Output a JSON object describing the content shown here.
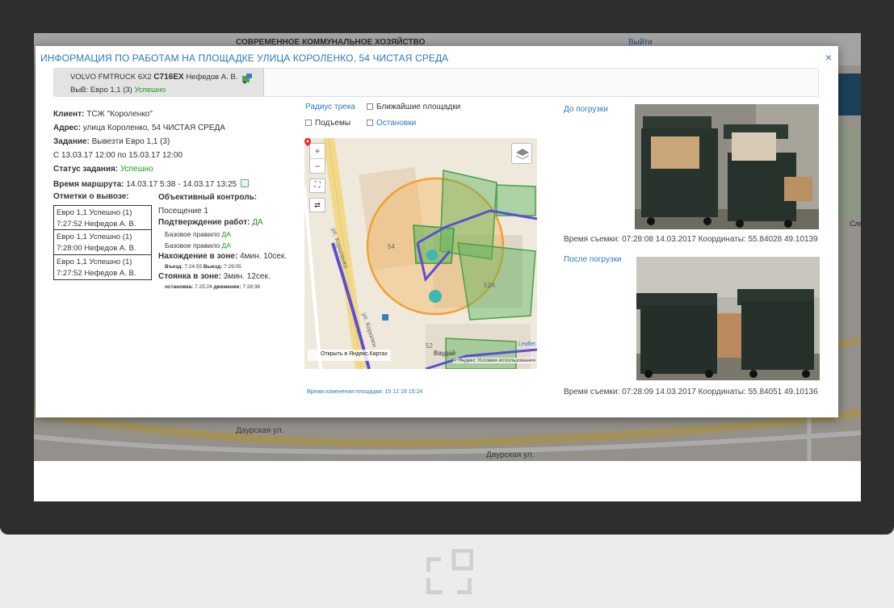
{
  "background": {
    "header_left": "СОВРЕМЕННОЕ КОММУНАЛЬНОЕ ХОЗЯЙСТВО",
    "header_right": "Выйти",
    "right_text": "Сло",
    "street_1": "Даурская ул.",
    "street_2": "Даурская ул."
  },
  "modal": {
    "title": "ИНФОРМАЦИЯ ПО РАБОТАМ НА ПЛОЩАДКЕ УЛИЦА КОРОЛЕНКО, 54 ЧИСТАЯ СРЕДА",
    "close": "×"
  },
  "truck": {
    "model": "VOLVO FMTRUCK 6X2",
    "plate": "С716ЕХ",
    "driver": "Нефедов А. В.",
    "task_prefix": "ВыВ: Евро 1,1 (3)",
    "status": "Успешно"
  },
  "info": {
    "client_label": "Клиент:",
    "client": "ТСЖ \"Короленко\"",
    "address_label": "Адрес:",
    "address": "улица Короленко, 54 ЧИСТАЯ СРЕДА",
    "task_label": "Задание:",
    "task": "Вывезти Евро 1,1 (3)",
    "period": "С 13.03.17 12:00 по 15.03.17 12:00",
    "status_label": "Статус задания:",
    "status": "Успешно",
    "route_label": "Время маршрута:",
    "route": "14.03.17 5:38 - 14.03.17 13:25"
  },
  "marks": {
    "title": "Отметки о вывозе:",
    "items": [
      {
        "line1": "Евро 1,1 Успешно (1)",
        "line2": "7:27:52 Нефедов А. В."
      },
      {
        "line1": "Евро 1,1 Успешно (1)",
        "line2": "7:28:00 Нефедов А. В."
      },
      {
        "line1": "Евро 1,1 Успешно (1)",
        "line2": "7:27:52 Нефедов А. В."
      }
    ]
  },
  "objective": {
    "title": "Объективный контроль:",
    "visit": "Посещение 1",
    "confirm_label": "Подтверждение работ:",
    "confirm_value": "ДА",
    "rule1_label": "Базовое правило",
    "rule1_value": "ДА",
    "rule2_label": "Базовое правило",
    "rule2_value": "ДА",
    "zone_label": "Нахождение в зоне:",
    "zone_value": "4мин. 10сек.",
    "entry_label": "Въезд:",
    "entry_time": "7:24:55",
    "exit_label": "Выезд:",
    "exit_time": "7:29:05",
    "parking_label": "Стоянка в зоне:",
    "parking_value": "3мин. 12сек.",
    "stop_label": "остановка:",
    "stop_time": "7:25:24",
    "move_label": "движение:",
    "move_time": "7:28:36"
  },
  "options": {
    "radius": "Радиус трека",
    "nearby": "Ближайшие площадки",
    "lifts": "Подъемы",
    "stops": "Остановки"
  },
  "map": {
    "zoom_in": "+",
    "zoom_out": "−",
    "street_a": "ул. Короленко",
    "street_b": "ул. Королен",
    "house_54": "54",
    "house_52": "52",
    "label_52a": "52А",
    "vaudai": "Ваудай",
    "yandex_link": "Открыть в Яндекс.Картах",
    "leaflet": "Leaflet",
    "attribution": "© Яндекс Условия использования"
  },
  "site_changed": "Время изменения площадки: 15.12.16 15:24",
  "photos": {
    "before_link": "До погрузки",
    "after_link": "После погрузки",
    "before_caption": "Время съемки: 07:28:08 14.03.2017  Координаты: 55.84028 49.10139",
    "after_caption": "Время съемки: 07:28:09 14.03.2017  Координаты: 55.84051 49.10136"
  }
}
